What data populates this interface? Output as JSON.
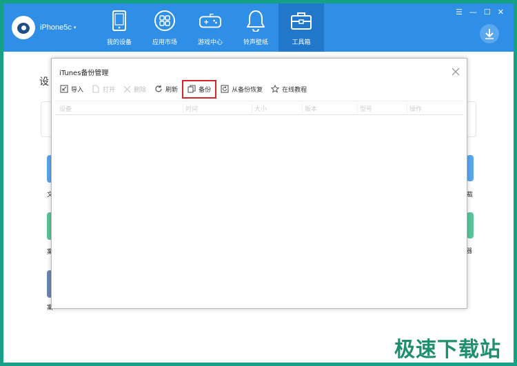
{
  "header": {
    "device_name": "iPhone5c",
    "caret": "▾",
    "nav": [
      {
        "label": "我的设备",
        "icon": "phone-icon"
      },
      {
        "label": "应用市场",
        "icon": "apps-grid-icon"
      },
      {
        "label": "游戏中心",
        "icon": "gamepad-icon"
      },
      {
        "label": "铃声壁纸",
        "icon": "bell-icon"
      },
      {
        "label": "工具箱",
        "icon": "toolbox-icon"
      }
    ],
    "active_nav": "工具箱",
    "window_controls": {
      "menu": "☰",
      "minimize": "—",
      "maximize": "☐",
      "close": "✕"
    }
  },
  "background": {
    "title": "设",
    "labels": [
      "文",
      "案",
      "案",
      "载",
      "拟器"
    ]
  },
  "dialog": {
    "title": "iTunes备份管理",
    "toolbar": [
      {
        "label": "导入",
        "icon": "import-icon",
        "disabled": false
      },
      {
        "label": "打开",
        "icon": "open-file-icon",
        "disabled": true
      },
      {
        "label": "删除",
        "icon": "delete-x-icon",
        "disabled": true
      },
      {
        "label": "刷新",
        "icon": "refresh-icon",
        "disabled": false
      },
      {
        "label": "备份",
        "icon": "backup-copy-icon",
        "disabled": false,
        "highlighted": true
      },
      {
        "label": "从备份恢复",
        "icon": "restore-icon",
        "disabled": false
      },
      {
        "label": "在线教程",
        "icon": "star-icon",
        "disabled": false
      }
    ],
    "columns": [
      "设备",
      "时间",
      "大小",
      "版本",
      "型号",
      "操作"
    ],
    "rows": []
  },
  "watermark": "极速下载站",
  "colors": {
    "header": "#2f8fe6",
    "active_tab": "#2177c9",
    "frame": "#16a085",
    "highlight": "#d4262a"
  }
}
